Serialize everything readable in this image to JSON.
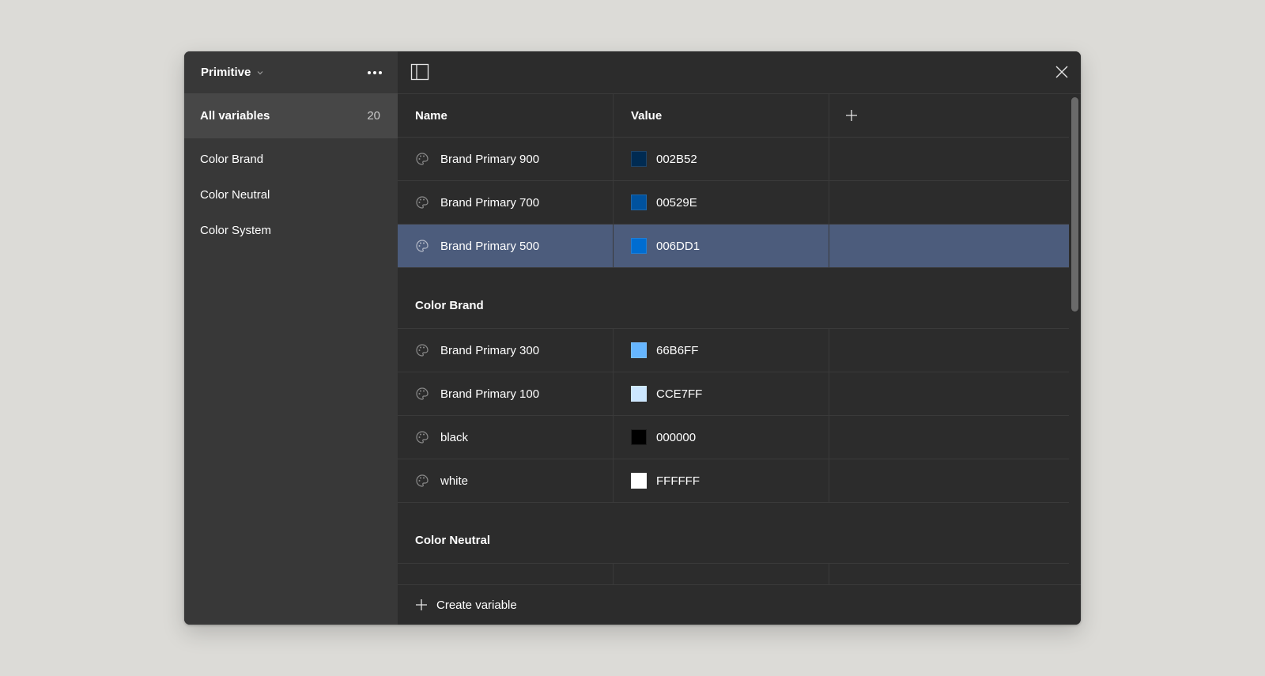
{
  "sidebar": {
    "collection_title": "Primitive",
    "all_variables": {
      "label": "All variables",
      "count": "20"
    },
    "groups": [
      {
        "label": "Color Brand"
      },
      {
        "label": "Color Neutral"
      },
      {
        "label": "Color System"
      }
    ]
  },
  "table": {
    "headers": {
      "name": "Name",
      "value": "Value"
    },
    "rows_top": [
      {
        "name": "Brand Primary 900",
        "value": "002B52",
        "color": "#002B52"
      },
      {
        "name": "Brand Primary 700",
        "value": "00529E",
        "color": "#00529E"
      },
      {
        "name": "Brand Primary 500",
        "value": "006DD1",
        "color": "#006DD1",
        "selected": true
      }
    ],
    "section_brand": {
      "title": "Color Brand",
      "rows": [
        {
          "name": "Brand Primary 300",
          "value": "66B6FF",
          "color": "#66B6FF"
        },
        {
          "name": "Brand Primary 100",
          "value": "CCE7FF",
          "color": "#CCE7FF"
        },
        {
          "name": "black",
          "value": "000000",
          "color": "#000000"
        },
        {
          "name": "white",
          "value": "FFFFFF",
          "color": "#FFFFFF"
        }
      ]
    },
    "section_neutral": {
      "title": "Color Neutral"
    }
  },
  "footer": {
    "create_label": "Create variable"
  },
  "icons": {
    "chevron": "chevron-down-icon",
    "more": "more-horizontal-icon",
    "panel": "sidebar-panel-icon",
    "close": "close-icon",
    "add": "plus-icon",
    "row": "palette-icon"
  },
  "colors": {
    "selected_row": "#4C5C7C",
    "sidebar_bg": "#383838",
    "main_bg": "#2C2C2C",
    "active_group_bg": "#474747"
  }
}
